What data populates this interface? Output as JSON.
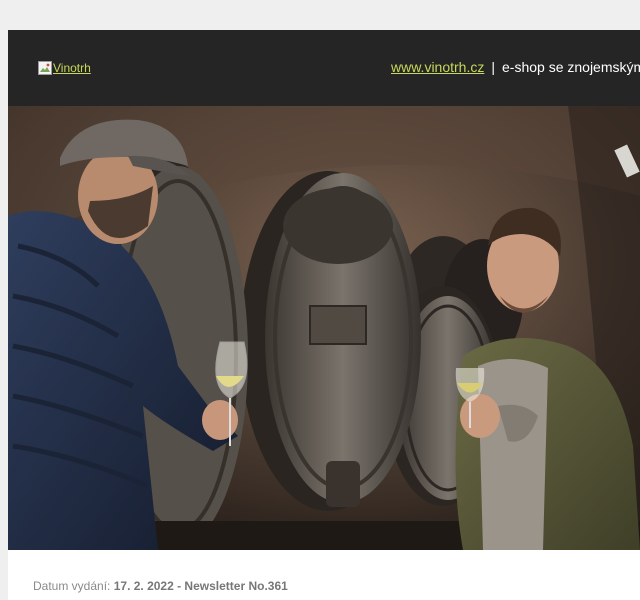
{
  "header": {
    "logo_alt": "Vinotrh",
    "site_link": "www.vinotrh.cz",
    "separator": "|",
    "tagline": "e-shop se znojemským"
  },
  "hero": {
    "icon": "photo-winemakers-in-cellar"
  },
  "issue": {
    "label": "Datum vydání:",
    "value": "17. 2. 2022 - Newsletter No.361"
  },
  "colors": {
    "page_bg": "#efefef",
    "header_bg": "#252525",
    "link": "#c8d85a",
    "meta_text": "#8a8a8a"
  }
}
